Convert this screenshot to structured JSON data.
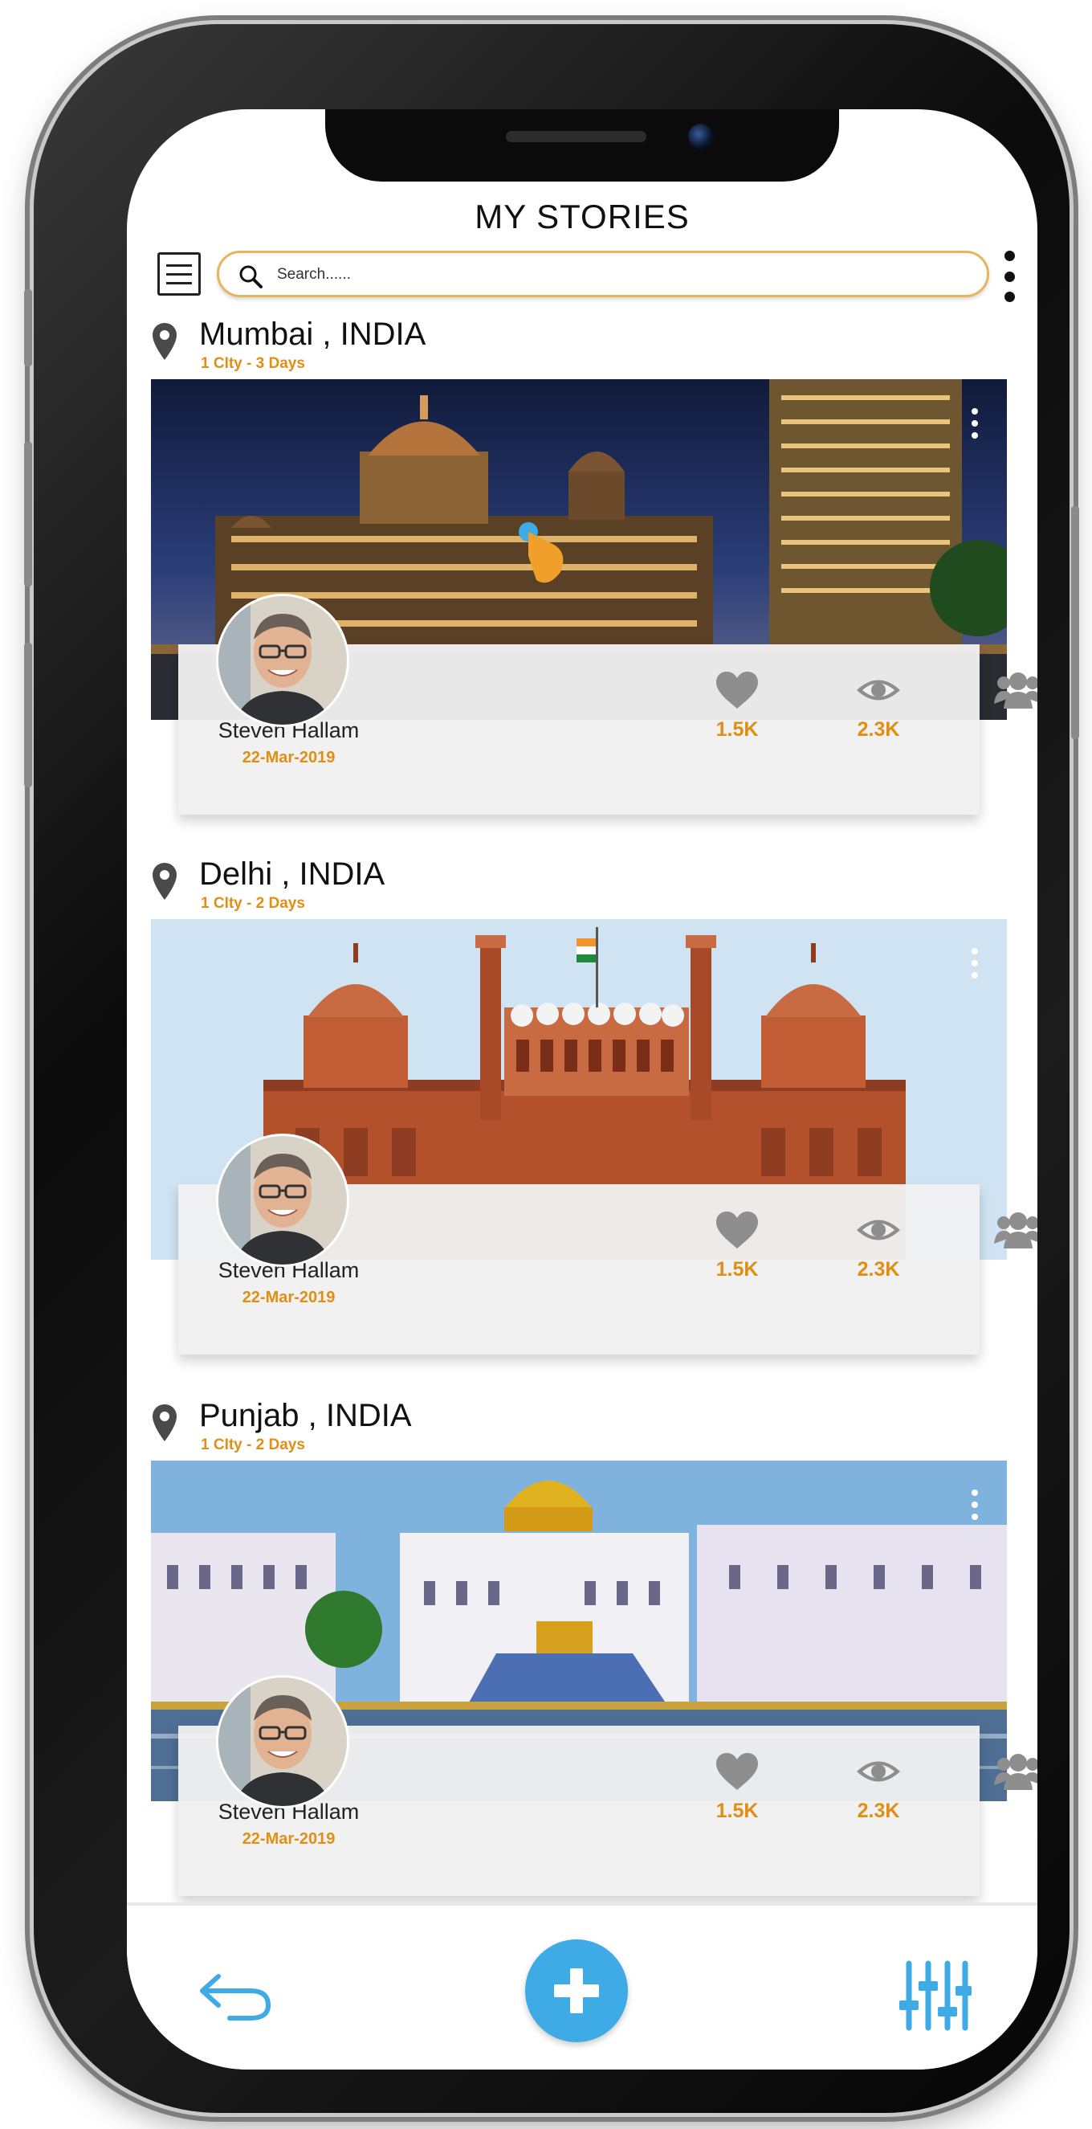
{
  "header": {
    "title": "MY STORIES",
    "search_placeholder": "Search......"
  },
  "stories": [
    {
      "city": "Mumbai , INDIA",
      "meta": "1 CIty - 3 Days",
      "author": "Steven Hallam",
      "date": "22-Mar-2019",
      "likes": "1.5K",
      "views": "2.3K"
    },
    {
      "city": "Delhi , INDIA",
      "meta": "1 CIty - 2 Days",
      "author": "Steven Hallam",
      "date": "22-Mar-2019",
      "likes": "1.5K",
      "views": "2.3K"
    },
    {
      "city": "Punjab , INDIA",
      "meta": "1 CIty - 2 Days",
      "author": "Steven Hallam",
      "date": "22-Mar-2019",
      "likes": "1.5K",
      "views": "2.3K"
    }
  ],
  "icons": {
    "menu": "hamburger-menu-icon",
    "search": "search-icon",
    "more": "vertical-dots-icon",
    "location": "map-pin-icon",
    "like": "heart-icon",
    "views": "eye-icon",
    "group": "group-icon",
    "back": "back-arrow-icon",
    "add": "plus-icon",
    "filter": "sliders-icon"
  },
  "colors": {
    "accent": "#e08f14",
    "primary_blue": "#3eaae6",
    "search_border": "#e8b45c",
    "icon_gray": "#8e8e8e"
  }
}
